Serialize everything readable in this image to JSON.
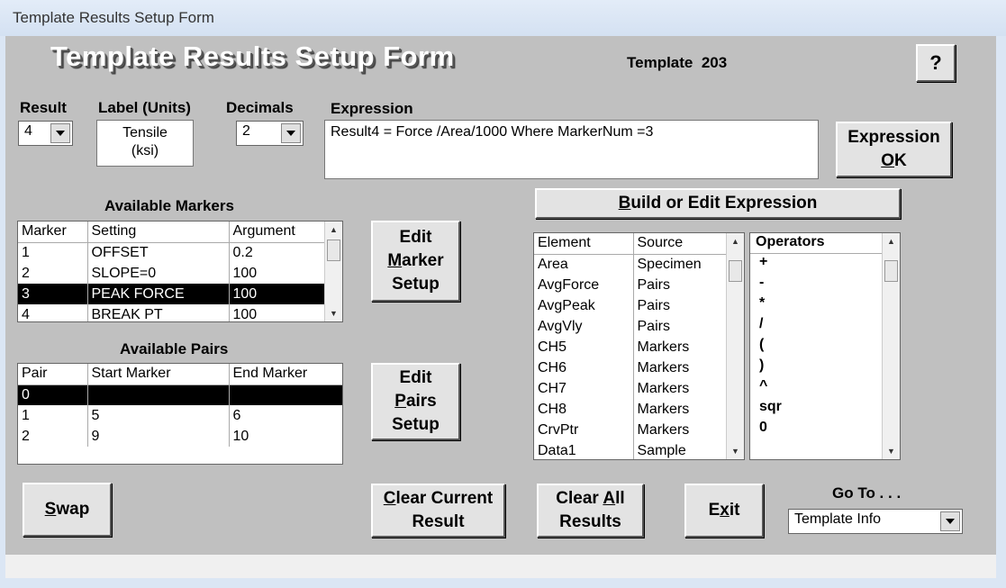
{
  "window": {
    "title": "Template Results Setup Form"
  },
  "header": {
    "title": "Template Results Setup Form",
    "template_label": "Template",
    "template_number": "203",
    "help_glyph": "?"
  },
  "labels": {
    "result": "Result",
    "label_units": "Label (Units)",
    "decimals": "Decimals",
    "expression": "Expression",
    "available_markers": "Available Markers",
    "available_pairs": "Available Pairs",
    "goto": "Go To . . ."
  },
  "fields": {
    "result_value": "4",
    "label_line1": "Tensile",
    "label_line2": "(ksi)",
    "decimals_value": "2",
    "expression_text": "Result4 = Force /Area/1000 Where MarkerNum =3",
    "goto_value": "Template Info"
  },
  "buttons": {
    "expression_ok_line1": "Expression",
    "expression_ok_line2_prefix": "",
    "expression_ok_line2_ul": "O",
    "expression_ok_line2_rest": "K",
    "build_prefix": "",
    "build_ul": "B",
    "build_rest": "uild or Edit Expression",
    "edit_marker_line1": "Edit",
    "edit_marker_ul": "M",
    "edit_marker_rest": "arker",
    "edit_marker_line3": "Setup",
    "edit_pairs_line1": "Edit",
    "edit_pairs_ul": "P",
    "edit_pairs_rest": "airs",
    "edit_pairs_line3": "Setup",
    "swap_ul": "S",
    "swap_rest": "wap",
    "clear_current_ul": "C",
    "clear_current_rest": "lear Current",
    "clear_current_line2": "Result",
    "clear_all_prefix": "Clear ",
    "clear_all_ul": "A",
    "clear_all_rest": "ll",
    "clear_all_line2": "Results",
    "exit_prefix": "E",
    "exit_ul": "x",
    "exit_rest": "it"
  },
  "markers": {
    "headers": [
      "Marker",
      "Setting",
      "Argument"
    ],
    "rows": [
      [
        "1",
        "OFFSET",
        "0.2"
      ],
      [
        "2",
        "SLOPE=0",
        "100"
      ],
      [
        "3",
        "PEAK FORCE",
        "100"
      ],
      [
        "4",
        "BREAK PT",
        "100"
      ]
    ],
    "selected_index": 2
  },
  "pairs": {
    "headers": [
      "Pair",
      "Start Marker",
      "End Marker"
    ],
    "rows": [
      [
        "0",
        "",
        ""
      ],
      [
        "1",
        "5",
        "6"
      ],
      [
        "2",
        "9",
        "10"
      ]
    ],
    "selected_index": 0
  },
  "elements": {
    "headers": [
      "Element",
      "Source"
    ],
    "rows": [
      [
        "Area",
        "Specimen"
      ],
      [
        "AvgForce",
        "Pairs"
      ],
      [
        "AvgPeak",
        "Pairs"
      ],
      [
        "AvgVly",
        "Pairs"
      ],
      [
        "CH5",
        "Markers"
      ],
      [
        "CH6",
        "Markers"
      ],
      [
        "CH7",
        "Markers"
      ],
      [
        "CH8",
        "Markers"
      ],
      [
        "CrvPtr",
        "Markers"
      ],
      [
        "Data1",
        "Sample"
      ]
    ]
  },
  "operators": {
    "header": "Operators",
    "items": [
      "+",
      "-",
      "*",
      "/",
      "(",
      ")",
      "^",
      "sqr",
      "0"
    ]
  }
}
